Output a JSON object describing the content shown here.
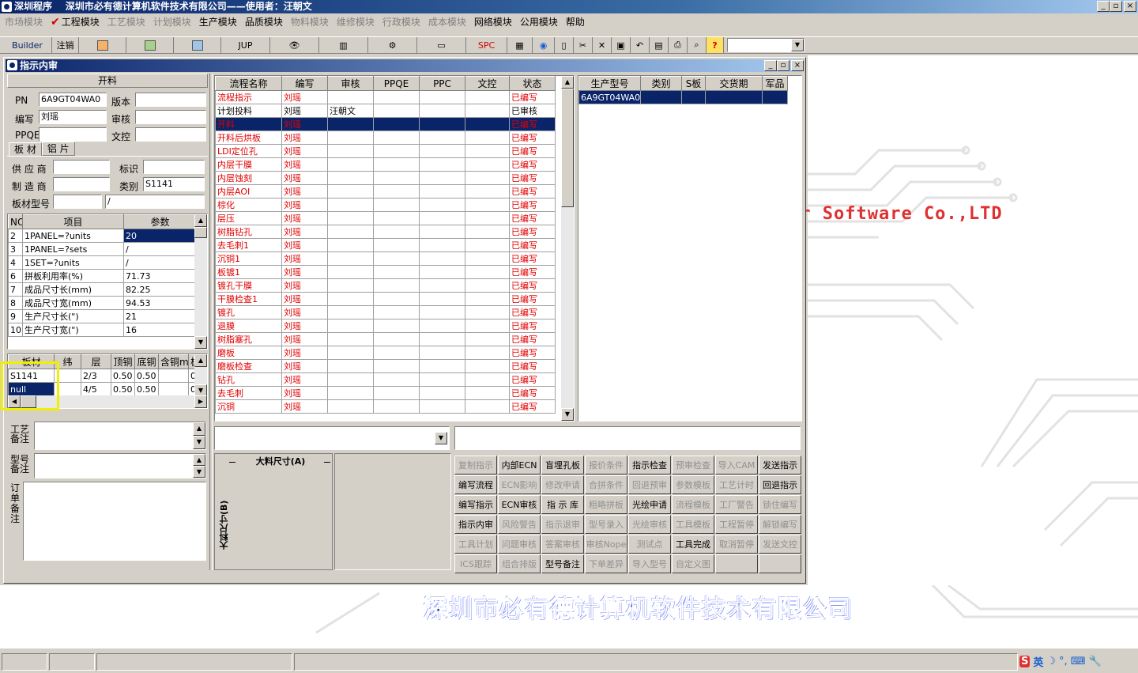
{
  "app": {
    "title": "深圳程序    深圳市必有德计算机软件技术有限公司——使用者：汪朝文",
    "window_buttons": [
      "_",
      "□",
      "×"
    ]
  },
  "menu": [
    {
      "label": "市场模块",
      "enabled": false
    },
    {
      "label": "工程模块",
      "enabled": true,
      "checked": true
    },
    {
      "label": "工艺模块",
      "enabled": false
    },
    {
      "label": "计划模块",
      "enabled": false
    },
    {
      "label": "生产模块",
      "enabled": true
    },
    {
      "label": "品质模块",
      "enabled": true
    },
    {
      "label": "物料模块",
      "enabled": false
    },
    {
      "label": "维修模块",
      "enabled": false
    },
    {
      "label": "行政模块",
      "enabled": false
    },
    {
      "label": "成本模块",
      "enabled": false
    },
    {
      "label": "网络模块",
      "enabled": true
    },
    {
      "label": "公用模块",
      "enabled": true
    },
    {
      "label": "帮助",
      "enabled": true
    }
  ],
  "toolbar": {
    "builder": "Builder",
    "logout": "注销",
    "jup": "JUP",
    "spc": "SPC",
    "help": "?",
    "icons": [
      "powerpoint-icon",
      "excel-icon",
      "word-icon",
      "eye-icon",
      "database-icon",
      "network-icon",
      "monitor-icon",
      "calculator-icon",
      "globe-icon",
      "new-icon",
      "cut-icon",
      "delete-icon",
      "save-icon",
      "undo-icon",
      "preview-icon",
      "print-icon",
      "find-icon"
    ]
  },
  "child": {
    "title": "指示内审",
    "section": "开料",
    "pn_label": "PN",
    "pn": "6A9GT04WA0",
    "version_label": "版本",
    "version": "",
    "writer_label": "编写",
    "writer": "刘瑶",
    "review_label": "审核",
    "review": "",
    "ppqe_label": "PPQE",
    "ppqe": "",
    "doc_label": "文控",
    "doc": "",
    "tabs": [
      "板 材",
      "铝 片"
    ],
    "supplier_label": "供 应 商",
    "supplier": "",
    "mark_label": "标识",
    "mark": "",
    "maker_label": "制 造 商",
    "maker": "",
    "category_label": "类别",
    "category": "S1141",
    "model_label": "板材型号",
    "model": "",
    "model2": "/",
    "params": {
      "headers": [
        "NO",
        "项目",
        "参数"
      ],
      "rows": [
        [
          "2",
          "1PANEL=?units",
          "20"
        ],
        [
          "3",
          "1PANEL=?sets",
          "/"
        ],
        [
          "4",
          "1SET=?units",
          "/"
        ],
        [
          "6",
          "拼板利用率(%)",
          "71.73"
        ],
        [
          "7",
          "成品尺寸长(mm)",
          "82.25"
        ],
        [
          "8",
          "成品尺寸宽(mm)",
          "94.53"
        ],
        [
          "9",
          "生产尺寸长(\")",
          "21"
        ],
        [
          "10",
          "生产尺寸宽(\")",
          "16"
        ]
      ]
    },
    "material": {
      "headers": [
        "板材",
        "纬",
        "层",
        "顶铜",
        "底铜",
        "含铜mm",
        "板"
      ],
      "rows": [
        [
          "S1141",
          "",
          "2/3",
          "0.50",
          "0.50",
          "",
          "0"
        ],
        [
          "null",
          "",
          "4/5",
          "0.50",
          "0.50",
          "",
          "0"
        ]
      ]
    },
    "process_note_label": "工艺备注",
    "model_note_label": "型号备注",
    "order_note_label": "订单备注",
    "flow": {
      "headers": [
        "流程名称",
        "编写",
        "审核",
        "PPQE",
        "PPC",
        "文控",
        "状态"
      ],
      "rows": [
        [
          "流程指示",
          "刘瑶",
          "",
          "",
          "",
          "",
          "已编写"
        ],
        [
          "计划投料",
          "刘瑶",
          "汪朝文",
          "",
          "",
          "",
          "已审核"
        ],
        [
          "开料",
          "刘瑶",
          "",
          "",
          "",
          "",
          "已编写"
        ],
        [
          "开料后烘板",
          "刘瑶",
          "",
          "",
          "",
          "",
          "已编写"
        ],
        [
          "LDI定位孔",
          "刘瑶",
          "",
          "",
          "",
          "",
          "已编写"
        ],
        [
          "内层干膜",
          "刘瑶",
          "",
          "",
          "",
          "",
          "已编写"
        ],
        [
          "内层蚀刻",
          "刘瑶",
          "",
          "",
          "",
          "",
          "已编写"
        ],
        [
          "内层AOI",
          "刘瑶",
          "",
          "",
          "",
          "",
          "已编写"
        ],
        [
          "棕化",
          "刘瑶",
          "",
          "",
          "",
          "",
          "已编写"
        ],
        [
          "层压",
          "刘瑶",
          "",
          "",
          "",
          "",
          "已编写"
        ],
        [
          "树脂钻孔",
          "刘瑶",
          "",
          "",
          "",
          "",
          "已编写"
        ],
        [
          "去毛刺1",
          "刘瑶",
          "",
          "",
          "",
          "",
          "已编写"
        ],
        [
          "沉铜1",
          "刘瑶",
          "",
          "",
          "",
          "",
          "已编写"
        ],
        [
          "板镀1",
          "刘瑶",
          "",
          "",
          "",
          "",
          "已编写"
        ],
        [
          "镀孔干膜",
          "刘瑶",
          "",
          "",
          "",
          "",
          "已编写"
        ],
        [
          "干膜检查1",
          "刘瑶",
          "",
          "",
          "",
          "",
          "已编写"
        ],
        [
          "镀孔",
          "刘瑶",
          "",
          "",
          "",
          "",
          "已编写"
        ],
        [
          "退膜",
          "刘瑶",
          "",
          "",
          "",
          "",
          "已编写"
        ],
        [
          "树脂塞孔",
          "刘瑶",
          "",
          "",
          "",
          "",
          "已编写"
        ],
        [
          "磨板",
          "刘瑶",
          "",
          "",
          "",
          "",
          "已编写"
        ],
        [
          "磨板检查",
          "刘瑶",
          "",
          "",
          "",
          "",
          "已编写"
        ],
        [
          "钻孔",
          "刘瑶",
          "",
          "",
          "",
          "",
          "已编写"
        ],
        [
          "去毛刺",
          "刘瑶",
          "",
          "",
          "",
          "",
          "已编写"
        ],
        [
          "沉铜",
          "刘瑶",
          "",
          "",
          "",
          "",
          "已编写"
        ]
      ]
    },
    "prod": {
      "headers": [
        "生产型号",
        "类别",
        "S板",
        "交货期",
        "军品"
      ],
      "rows": [
        [
          "6A9GT04WA0",
          "",
          "",
          "",
          ""
        ]
      ]
    },
    "dim_a": "大料尺寸(A)",
    "dim_b": "大料尺寸(B)",
    "buttons": [
      [
        {
          "t": "复制指示",
          "e": false
        },
        {
          "t": "内部ECN",
          "e": true
        },
        {
          "t": "盲埋孔板",
          "e": true
        },
        {
          "t": "报价条件",
          "e": false
        },
        {
          "t": "指示检查",
          "e": true
        },
        {
          "t": "预审检查",
          "e": false
        },
        {
          "t": "导入CAM",
          "e": false
        },
        {
          "t": "发送指示",
          "e": true
        }
      ],
      [
        {
          "t": "编写流程",
          "e": true
        },
        {
          "t": "ECN影响",
          "e": false
        },
        {
          "t": "修改申请",
          "e": false
        },
        {
          "t": "合拼条件",
          "e": false
        },
        {
          "t": "回退预审",
          "e": false
        },
        {
          "t": "参数模板",
          "e": false
        },
        {
          "t": "工艺计时",
          "e": false
        },
        {
          "t": "回退指示",
          "e": true
        }
      ],
      [
        {
          "t": "编写指示",
          "e": true
        },
        {
          "t": "ECN审核",
          "e": true
        },
        {
          "t": "指 示 库",
          "e": true
        },
        {
          "t": "粗略拼板",
          "e": false
        },
        {
          "t": "光绘申请",
          "e": true
        },
        {
          "t": "流程模板",
          "e": false
        },
        {
          "t": "工厂警告",
          "e": false
        },
        {
          "t": "锁住编写",
          "e": false
        }
      ],
      [
        {
          "t": "指示内审",
          "e": true
        },
        {
          "t": "风险警告",
          "e": false
        },
        {
          "t": "指示退审",
          "e": false
        },
        {
          "t": "型号录入",
          "e": false
        },
        {
          "t": "光绘审核",
          "e": false
        },
        {
          "t": "工具模板",
          "e": false
        },
        {
          "t": "工程暂停",
          "e": false
        },
        {
          "t": "解锁编写",
          "e": false
        }
      ],
      [
        {
          "t": "工具计划",
          "e": false
        },
        {
          "t": "问题审核",
          "e": false
        },
        {
          "t": "答案审核",
          "e": false
        },
        {
          "t": "审核Nope",
          "e": false
        },
        {
          "t": "测试点",
          "e": false
        },
        {
          "t": "工具完成",
          "e": true
        },
        {
          "t": "取消暂停",
          "e": false
        },
        {
          "t": "发送文控",
          "e": false
        }
      ],
      [
        {
          "t": "ICS跟踪",
          "e": false
        },
        {
          "t": "组合排版",
          "e": false
        },
        {
          "t": "型号备注",
          "e": true
        },
        {
          "t": "下单差异",
          "e": false
        },
        {
          "t": "导入型号",
          "e": false
        },
        {
          "t": "自定义图",
          "e": false
        },
        {
          "t": "",
          "e": false
        },
        {
          "t": "",
          "e": false
        }
      ]
    ]
  },
  "background": {
    "slogan": "er Software Co.,LTD",
    "company": "深圳市必有德计算机软件技术有限公司"
  },
  "tray": {
    "ime": "英",
    "items": [
      "S",
      "英",
      "☽",
      "°,",
      "⌨",
      "🔧"
    ]
  },
  "colors": {
    "title_start": "#0a246a",
    "selection": "#0a246a",
    "text_red": "#e00000",
    "highlight": "#f0f000"
  }
}
